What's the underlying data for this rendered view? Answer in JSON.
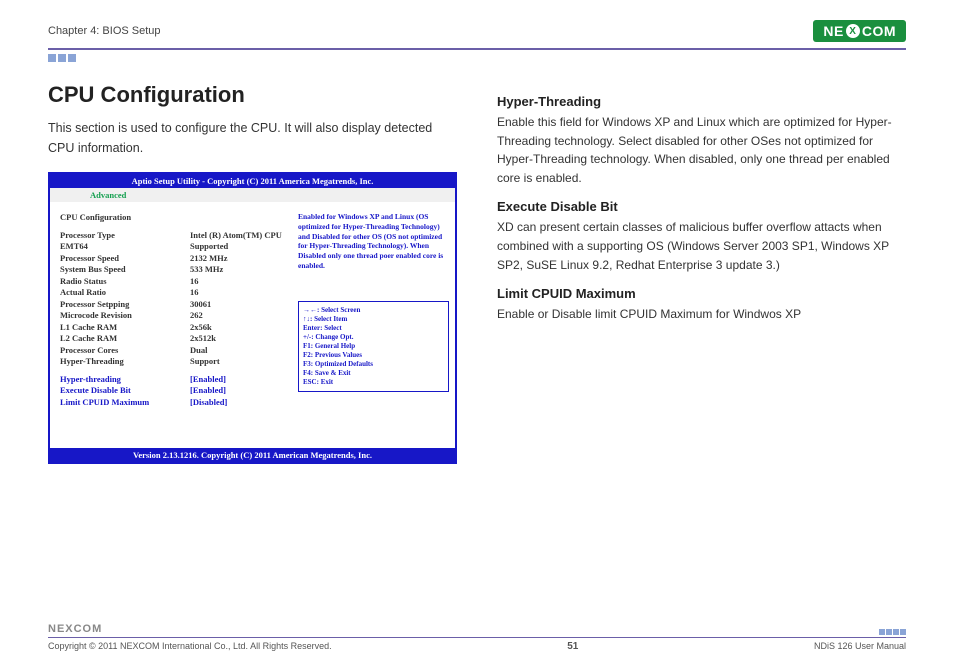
{
  "header": {
    "chapter": "Chapter 4: BIOS Setup",
    "logo_pre": "NE",
    "logo_x": "X",
    "logo_post": "COM"
  },
  "left": {
    "title": "CPU Configuration",
    "intro": "This section is used to configure the CPU. It will also display detected CPU information."
  },
  "bios": {
    "title": "Aptio Setup Utility - Copyright (C) 2011 America Megatrends, Inc.",
    "tab_active": "Advanced",
    "heading": "CPU Configuration",
    "rows": [
      {
        "label": "Processor Type",
        "value": "Intel (R) Atom(TM) CPU"
      },
      {
        "label": "EMT64",
        "value": "Supported"
      },
      {
        "label": "Processor Speed",
        "value": "2132  MHz"
      },
      {
        "label": "System Bus Speed",
        "value": "533 MHz"
      },
      {
        "label": "Radio Status",
        "value": "16"
      },
      {
        "label": "Actual Ratio",
        "value": "16"
      },
      {
        "label": "Processor Setpping",
        "value": "30061"
      },
      {
        "label": "Microcode Revision",
        "value": "262"
      },
      {
        "label": "L1 Cache RAM",
        "value": "2x56k"
      },
      {
        "label": "L2 Cache RAM",
        "value": "2x512k"
      },
      {
        "label": "Processor Cores",
        "value": "Dual"
      },
      {
        "label": "Hyper-Threading",
        "value": "Support"
      }
    ],
    "options": [
      {
        "label": "Hyper-threading",
        "value": "[Enabled]"
      },
      {
        "label": "Execute Disable Bit",
        "value": "[Enabled]"
      },
      {
        "label": "Limit CPUID Maximum",
        "value": "[Disabled]"
      }
    ],
    "help": "Enabled for Windows XP and Linux (OS optimized for Hyper-Threading Technology) and Disabled for other OS (OS not optimized for Hyper-Threading Technology). When Disabled only one thread poer enabled core is enabled.",
    "keys": [
      "→←: Select Screen",
      "↑↓: Select Item",
      "Enter: Select",
      "+/-: Change Opt.",
      "F1: General Help",
      "F2: Previous Values",
      "F3: Optimized Defaults",
      "F4: Save & Exit",
      "ESC: Exit"
    ],
    "footer": "Version 2.13.1216. Copyright (C) 2011 American Megatrends, Inc."
  },
  "right": {
    "sections": [
      {
        "title": "Hyper-Threading",
        "body": "Enable this field for Windows XP and Linux which are optimized for Hyper-Threading technology. Select disabled for other OSes not optimized for Hyper-Threading technology. When disabled, only one thread per enabled core is enabled."
      },
      {
        "title": "Execute Disable Bit",
        "body": "XD can present certain classes of malicious buffer overflow attacts when combined with a supporting OS (Windows Server 2003 SP1, Windows XP SP2, SuSE Linux 9.2, Redhat Enterprise 3 update 3.)"
      },
      {
        "title": "Limit CPUID Maximum",
        "body": "Enable or Disable limit CPUID Maximum for Windwos XP"
      }
    ]
  },
  "footer": {
    "logo": "NEXCOM",
    "copyright": "Copyright © 2011 NEXCOM International Co., Ltd. All Rights Reserved.",
    "page": "51",
    "manual": "NDiS 126 User Manual"
  }
}
